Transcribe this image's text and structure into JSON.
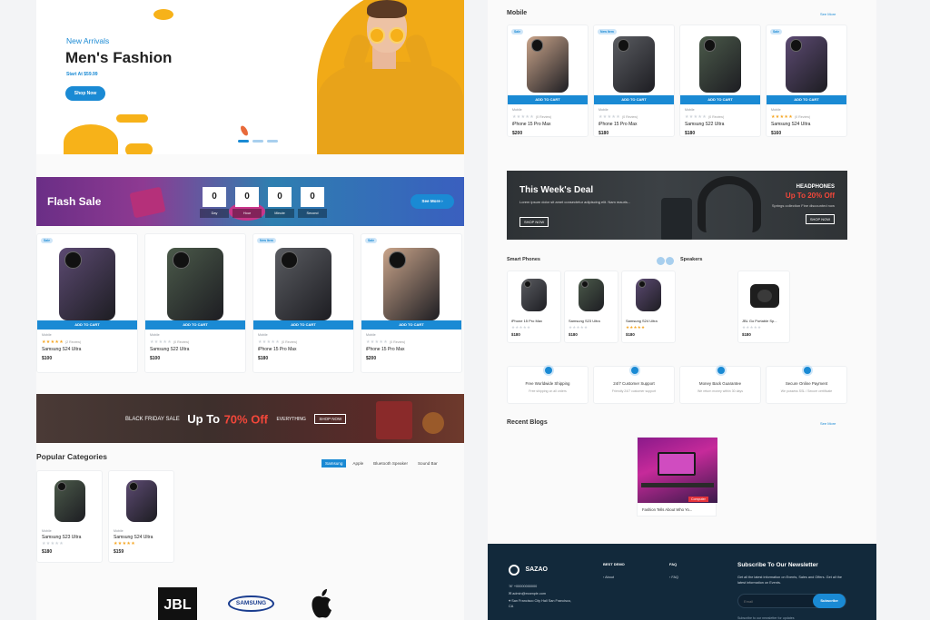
{
  "hero": {
    "eyebrow": "New Arrivals",
    "title": "Men's Fashion",
    "price_line": "Start At $59.99",
    "button": "Shop Now"
  },
  "flash": {
    "title": "Flash Sale",
    "countdown": [
      {
        "value": "0",
        "label": "Day"
      },
      {
        "value": "0",
        "label": "Hour"
      },
      {
        "value": "0",
        "label": "Minute"
      },
      {
        "value": "0",
        "label": "Second"
      }
    ],
    "button": "See More"
  },
  "flash_products": [
    {
      "badge": "Sale",
      "cat": "Mobile",
      "stars": 5,
      "reviews": "(2 Review)",
      "name": "Samsung S24 Ultra",
      "price": "$100",
      "color": "#5c4a72",
      "button": "ADD TO CART"
    },
    {
      "badge": "",
      "cat": "Mobile",
      "stars": 0,
      "reviews": "(0 Review)",
      "name": "Samsung S22 Ultra",
      "price": "$100",
      "color": "#4b5a4a",
      "button": "ADD TO CART"
    },
    {
      "badge": "New Item",
      "cat": "Mobile",
      "stars": 0,
      "reviews": "(0 Review)",
      "name": "iPhone 15 Pro Max",
      "price": "$180",
      "color": "#5a5c61",
      "button": "ADD TO CART"
    },
    {
      "badge": "Sale",
      "cat": "Mobile",
      "stars": 0,
      "reviews": "(0 Review)",
      "name": "iPhone 15 Pro Max",
      "price": "$200",
      "color": "#c9a48a",
      "button": "ADD TO CART"
    }
  ],
  "black_friday": {
    "prefix": "BLACK FRIDAY SALE",
    "headline": "Up To",
    "percent": "70% Off",
    "suffix": "EVERYTHING",
    "button": "SHOP NOW"
  },
  "popular": {
    "title": "Popular Categories",
    "tabs": [
      "Samsung",
      "Apple",
      "Bluetooth Speaker",
      "Sound Bar"
    ],
    "items": [
      {
        "cat": "Mobile",
        "stars": 0,
        "name": "Samsung S23 Ultra",
        "price": "$180",
        "color": "#4b5a4a"
      },
      {
        "cat": "Mobile",
        "stars": 5,
        "name": "Samsung S24 Ultra",
        "price": "$159",
        "color": "#5c4a72"
      }
    ]
  },
  "brands": [
    "JBL",
    "SAMSUNG"
  ],
  "mobile": {
    "title": "Mobile",
    "view_more": "See More",
    "products": [
      {
        "badge": "Sale",
        "cat": "Mobile",
        "stars": 0,
        "reviews": "(0 Review)",
        "name": "iPhone 15 Pro Max",
        "price": "$200",
        "color": "#c9a48a",
        "button": "ADD TO CART"
      },
      {
        "badge": "New Item",
        "cat": "Mobile",
        "stars": 0,
        "reviews": "(0 Review)",
        "name": "iPhone 15 Pro Max",
        "price": "$180",
        "color": "#5a5c61",
        "button": "ADD TO CART"
      },
      {
        "badge": "",
        "cat": "Mobile",
        "stars": 0,
        "reviews": "(0 Review)",
        "name": "Samsung S22 Ultra",
        "price": "$180",
        "color": "#4b5a4a",
        "button": "ADD TO CART"
      },
      {
        "badge": "Sale",
        "cat": "Mobile",
        "stars": 5,
        "reviews": "(0 Review)",
        "name": "Samsung S24 Ultra",
        "price": "$160",
        "color": "#5c4a72",
        "button": "ADD TO CART"
      }
    ]
  },
  "week_deal": {
    "title": "This Week's Deal",
    "desc": "Lorem ipsum dolor sit amet consectetur adipiscing elit. Nam mauris...",
    "button": "SHOP NOW",
    "right_label": "HEADPHONES",
    "right_offer": "Up To 20% Off",
    "right_desc": "Springs collection Fine discounted now",
    "right_button": "SHOP NOW"
  },
  "smart_phones": {
    "title": "Smart Phones",
    "items": [
      {
        "name": "iPhone 15 Pro Max",
        "stars": 0,
        "price": "$180",
        "color": "#5a5c61"
      },
      {
        "name": "Samsung S23 Ultra",
        "stars": 0,
        "price": "$180",
        "color": "#4b5a4a"
      },
      {
        "name": "Samsung S24 Ultra",
        "stars": 5,
        "price": "$180",
        "color": "#5c4a72"
      }
    ]
  },
  "speakers": {
    "title": "Speakers",
    "items": [
      {
        "name": "JBL Go Portable Sp...",
        "stars": 0,
        "price": "$180"
      }
    ]
  },
  "features": [
    {
      "icon": "truck-icon",
      "title": "Free Worldwide Shipping",
      "desc": "Free shipping on all orders"
    },
    {
      "icon": "headset-icon",
      "title": "24/7 Customer Support",
      "desc": "Friendly 24/7 customer support"
    },
    {
      "icon": "refund-icon",
      "title": "Money Back Guarantee",
      "desc": "We return money within 30 days"
    },
    {
      "icon": "card-icon",
      "title": "Secure Online Payment",
      "desc": "We possess SSL / Secure certificate"
    }
  ],
  "blogs": {
    "title": "Recent Blogs",
    "view_more": "See More",
    "tag": "Computer",
    "post_title": "Fashion Tells About Who Yo..."
  },
  "footer": {
    "logo": "SAZAO",
    "phone": "+00000000000",
    "email": "admin@example.com",
    "address": "San Francisco City Hall San Francisco, CA",
    "col1_title": "BEST DEMO",
    "col1_item": "About",
    "col2_title": "FAQ",
    "col2_item": "FAQ",
    "newsletter_title": "Subscribe To Our Newsletter",
    "newsletter_desc": "Get all the latest information on Events, Sales and Offers. Get all the latest information on Events.",
    "email_placeholder": "Email",
    "subscribe": "Subscribe",
    "note": "Subscribe to our newsletter for updates"
  }
}
